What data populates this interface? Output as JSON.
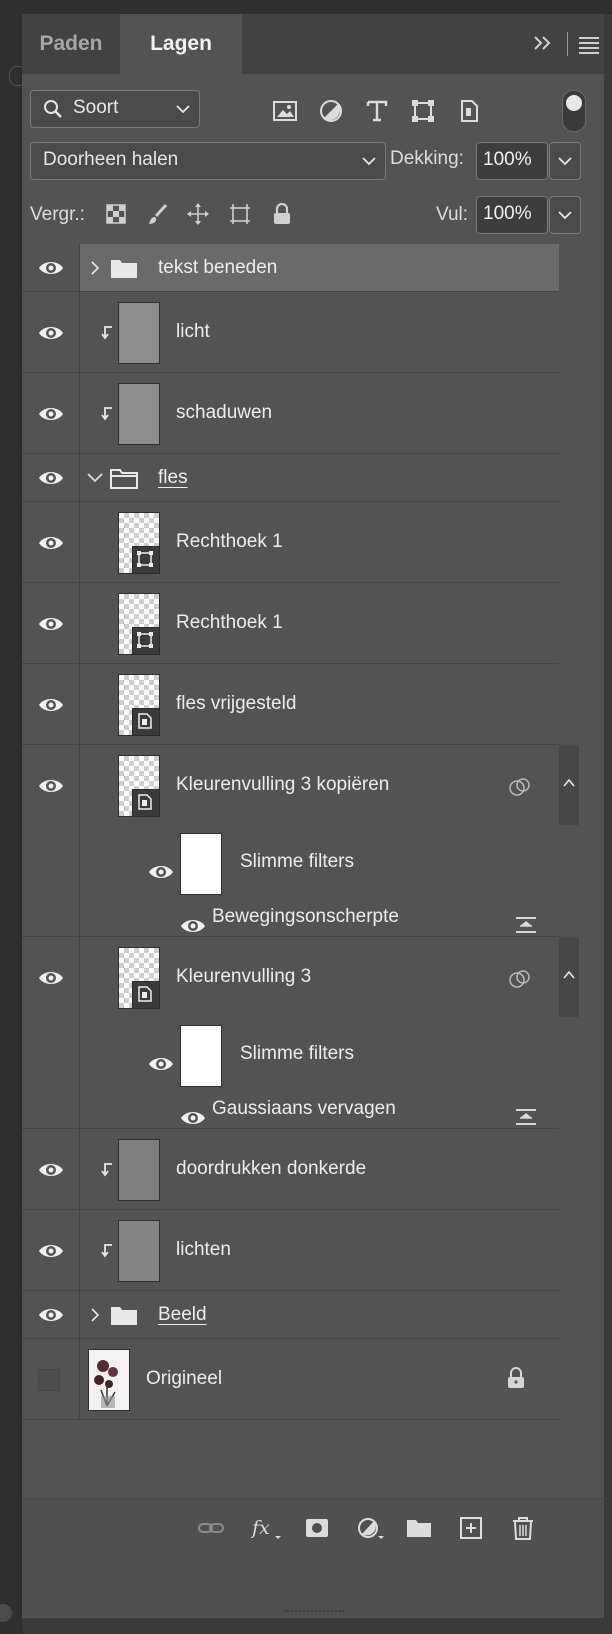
{
  "tabs": [
    {
      "label": "Paden",
      "active": false
    },
    {
      "label": "Lagen",
      "active": true
    }
  ],
  "filter": {
    "kind_label": "Soort"
  },
  "blend": {
    "mode": "Doorheen halen",
    "opacity_label": "Dekking:",
    "opacity_value": "100%"
  },
  "locks": {
    "label": "Vergr.:",
    "fill_label": "Vul:",
    "fill_value": "100%"
  },
  "layers": [
    {
      "name": "tekst beneden",
      "kind": "group",
      "collapsed": true,
      "selected": true,
      "visible": true
    },
    {
      "name": "licht",
      "kind": "pixel",
      "clipped": true,
      "visible": true
    },
    {
      "name": "schaduwen",
      "kind": "pixel",
      "clipped": true,
      "visible": true
    },
    {
      "name": "fles",
      "kind": "group",
      "collapsed": false,
      "visible": true
    },
    {
      "name": "Rechthoek 1",
      "kind": "shape",
      "visible": true
    },
    {
      "name": "Rechthoek 1",
      "kind": "shape",
      "visible": true
    },
    {
      "name": "fles vrijgesteld",
      "kind": "smart-object",
      "visible": true
    },
    {
      "name": "Kleurenvulling 3 kopiëren",
      "kind": "smart-object",
      "visible": true,
      "smart_filters_label": "Slimme filters",
      "filter_name": "Bewegingsonscherpte"
    },
    {
      "name": "Kleurenvulling 3",
      "kind": "smart-object",
      "visible": true,
      "smart_filters_label": "Slimme filters",
      "filter_name": "Gaussiaans vervagen"
    },
    {
      "name": "doordrukken donkerde",
      "kind": "pixel",
      "clipped": true,
      "visible": true
    },
    {
      "name": "lichten",
      "kind": "pixel",
      "clipped": true,
      "visible": true
    },
    {
      "name": "Beeld",
      "kind": "group",
      "collapsed": true,
      "visible": true
    },
    {
      "name": "Origineel",
      "kind": "background",
      "visible": false,
      "locked": true
    }
  ],
  "colors": {
    "panel": "#535353",
    "selected_row": "#6a6a6a",
    "tabbar": "#424242"
  }
}
